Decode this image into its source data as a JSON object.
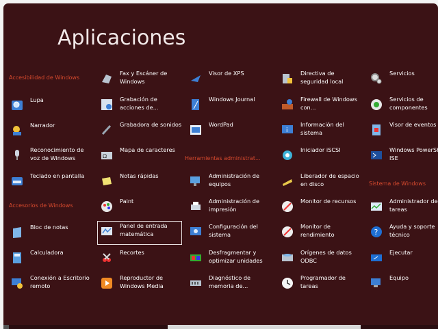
{
  "title": "Aplicaciones",
  "groups": {
    "accesibilidad": "Accesibilidad de Windows",
    "accesorios": "Accesorios de Windows",
    "herramientas": "Herramientas administrat...",
    "sistema": "Sistema de Windows"
  },
  "apps": [
    {
      "id": "lupa",
      "label": "Lupa",
      "icon": "magnifier-icon"
    },
    {
      "id": "narrador",
      "label": "Narrador",
      "icon": "narrator-icon"
    },
    {
      "id": "voz",
      "label": "Reconocimiento de voz de Windows",
      "icon": "microphone-icon"
    },
    {
      "id": "teclado",
      "label": "Teclado en pantalla",
      "icon": "keyboard-icon"
    },
    {
      "id": "bloc",
      "label": "Bloc de notas",
      "icon": "notepad-icon"
    },
    {
      "id": "calc",
      "label": "Calculadora",
      "icon": "calculator-icon"
    },
    {
      "id": "rdp",
      "label": "Conexión a Escritorio remoto",
      "icon": "remote-desktop-icon"
    },
    {
      "id": "fax",
      "label": "Fax y Escáner de Windows",
      "icon": "fax-icon"
    },
    {
      "id": "grab_acc",
      "label": "Grabación de acciones de...",
      "icon": "steps-recorder-icon"
    },
    {
      "id": "grab_son",
      "label": "Grabadora de sonidos",
      "icon": "sound-recorder-icon"
    },
    {
      "id": "mapa",
      "label": "Mapa de caracteres",
      "icon": "character-map-icon"
    },
    {
      "id": "notas",
      "label": "Notas rápidas",
      "icon": "sticky-notes-icon"
    },
    {
      "id": "paint",
      "label": "Paint",
      "icon": "paint-icon"
    },
    {
      "id": "panel",
      "label": "Panel de entrada matemática",
      "icon": "math-input-icon"
    },
    {
      "id": "recortes",
      "label": "Recortes",
      "icon": "snipping-icon"
    },
    {
      "id": "wmp",
      "label": "Reproductor de Windows Media",
      "icon": "media-player-icon"
    },
    {
      "id": "xps",
      "label": "Visor de XPS",
      "icon": "xps-viewer-icon"
    },
    {
      "id": "journal",
      "label": "Windows Journal",
      "icon": "journal-icon"
    },
    {
      "id": "wordpad",
      "label": "WordPad",
      "icon": "wordpad-icon"
    },
    {
      "id": "adm_eq",
      "label": "Administración de equipos",
      "icon": "computer-management-icon"
    },
    {
      "id": "adm_imp",
      "label": "Administración de impresión",
      "icon": "print-management-icon"
    },
    {
      "id": "config",
      "label": "Configuración del sistema",
      "icon": "system-config-icon"
    },
    {
      "id": "desfrag",
      "label": "Desfragmentar y optimizar unidades",
      "icon": "defrag-icon"
    },
    {
      "id": "diag",
      "label": "Diagnóstico de memoria de...",
      "icon": "memory-diagnostic-icon"
    },
    {
      "id": "directiva",
      "label": "Directiva de seguridad local",
      "icon": "security-policy-icon"
    },
    {
      "id": "firewall",
      "label": "Firewall de Windows con...",
      "icon": "firewall-icon"
    },
    {
      "id": "info",
      "label": "Información del sistema",
      "icon": "system-info-icon"
    },
    {
      "id": "iscsi",
      "label": "Iniciador iSCSI",
      "icon": "iscsi-icon"
    },
    {
      "id": "liberador",
      "label": "Liberador de espacio en disco",
      "icon": "disk-cleanup-icon"
    },
    {
      "id": "mon_rec",
      "label": "Monitor de recursos",
      "icon": "resource-monitor-icon"
    },
    {
      "id": "mon_ren",
      "label": "Monitor de rendimiento",
      "icon": "performance-monitor-icon"
    },
    {
      "id": "odbc",
      "label": "Orígenes de datos ODBC",
      "icon": "odbc-icon"
    },
    {
      "id": "prog",
      "label": "Programador de tareas",
      "icon": "task-scheduler-icon"
    },
    {
      "id": "servicios",
      "label": "Servicios",
      "icon": "services-icon"
    },
    {
      "id": "serv_comp",
      "label": "Servicios de componentes",
      "icon": "component-services-icon"
    },
    {
      "id": "visor_ev",
      "label": "Visor de eventos",
      "icon": "event-viewer-icon"
    },
    {
      "id": "pwsh",
      "label": "Windows PowerShell ISE",
      "icon": "powershell-icon"
    },
    {
      "id": "adm_tar",
      "label": "Administrador de tareas",
      "icon": "task-manager-icon"
    },
    {
      "id": "ayuda",
      "label": "Ayuda y soporte técnico",
      "icon": "help-icon"
    },
    {
      "id": "ejecutar",
      "label": "Ejecutar",
      "icon": "run-icon"
    },
    {
      "id": "equipo",
      "label": "Equipo",
      "icon": "computer-icon"
    }
  ]
}
